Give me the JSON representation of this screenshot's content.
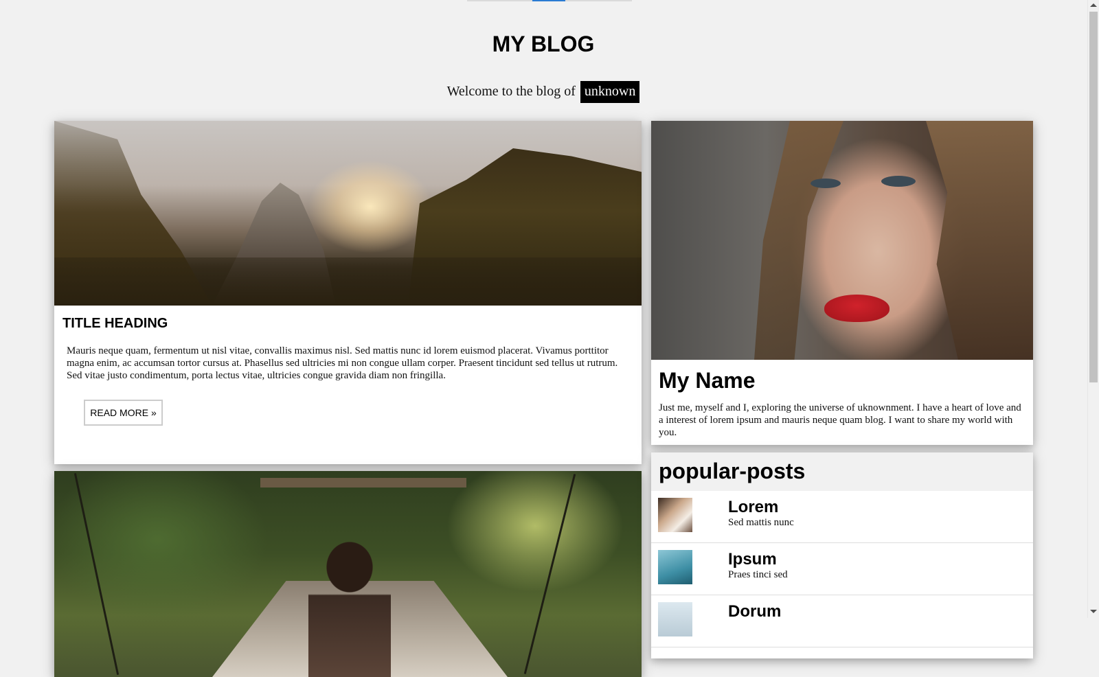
{
  "header": {
    "title": "MY BLOG",
    "welcome_text": "Welcome to the blog of",
    "welcome_name": "unknown"
  },
  "posts": [
    {
      "image": "mountain-sunset-image",
      "title": "TITLE HEADING",
      "body": "Mauris neque quam, fermentum ut nisl vitae, convallis maximus nisl. Sed mattis nunc id lorem euismod placerat. Vivamus porttitor magna enim, ac accumsan tortor cursus at. Phasellus sed ultricies mi non congue ullam corper. Praesent tincidunt sed tellus ut rutrum. Sed vitae justo condimentum, porta lectus vitae, ultricies congue gravida diam non fringilla.",
      "read_more_label": "READ MORE »"
    },
    {
      "image": "bridge-forest-image"
    }
  ],
  "about": {
    "image": "portrait-image",
    "name": "My Name",
    "text": "Just me, myself and I, exploring the universe of uknownment. I have a heart of love and a interest of lorem ipsum and mauris neque quam blog. I want to share my world with you."
  },
  "popular_posts": {
    "title": "popular-posts",
    "items": [
      {
        "name": "Lorem",
        "subtitle": "Sed mattis nunc"
      },
      {
        "name": "Ipsum",
        "subtitle": "Praes tinci sed"
      },
      {
        "name": "Dorum",
        "subtitle": ""
      }
    ]
  },
  "colors": {
    "page_background": "#f1f1f1",
    "card_background": "#ffffff",
    "tag_background": "#000000",
    "nav_active": "#2a7bd3"
  }
}
